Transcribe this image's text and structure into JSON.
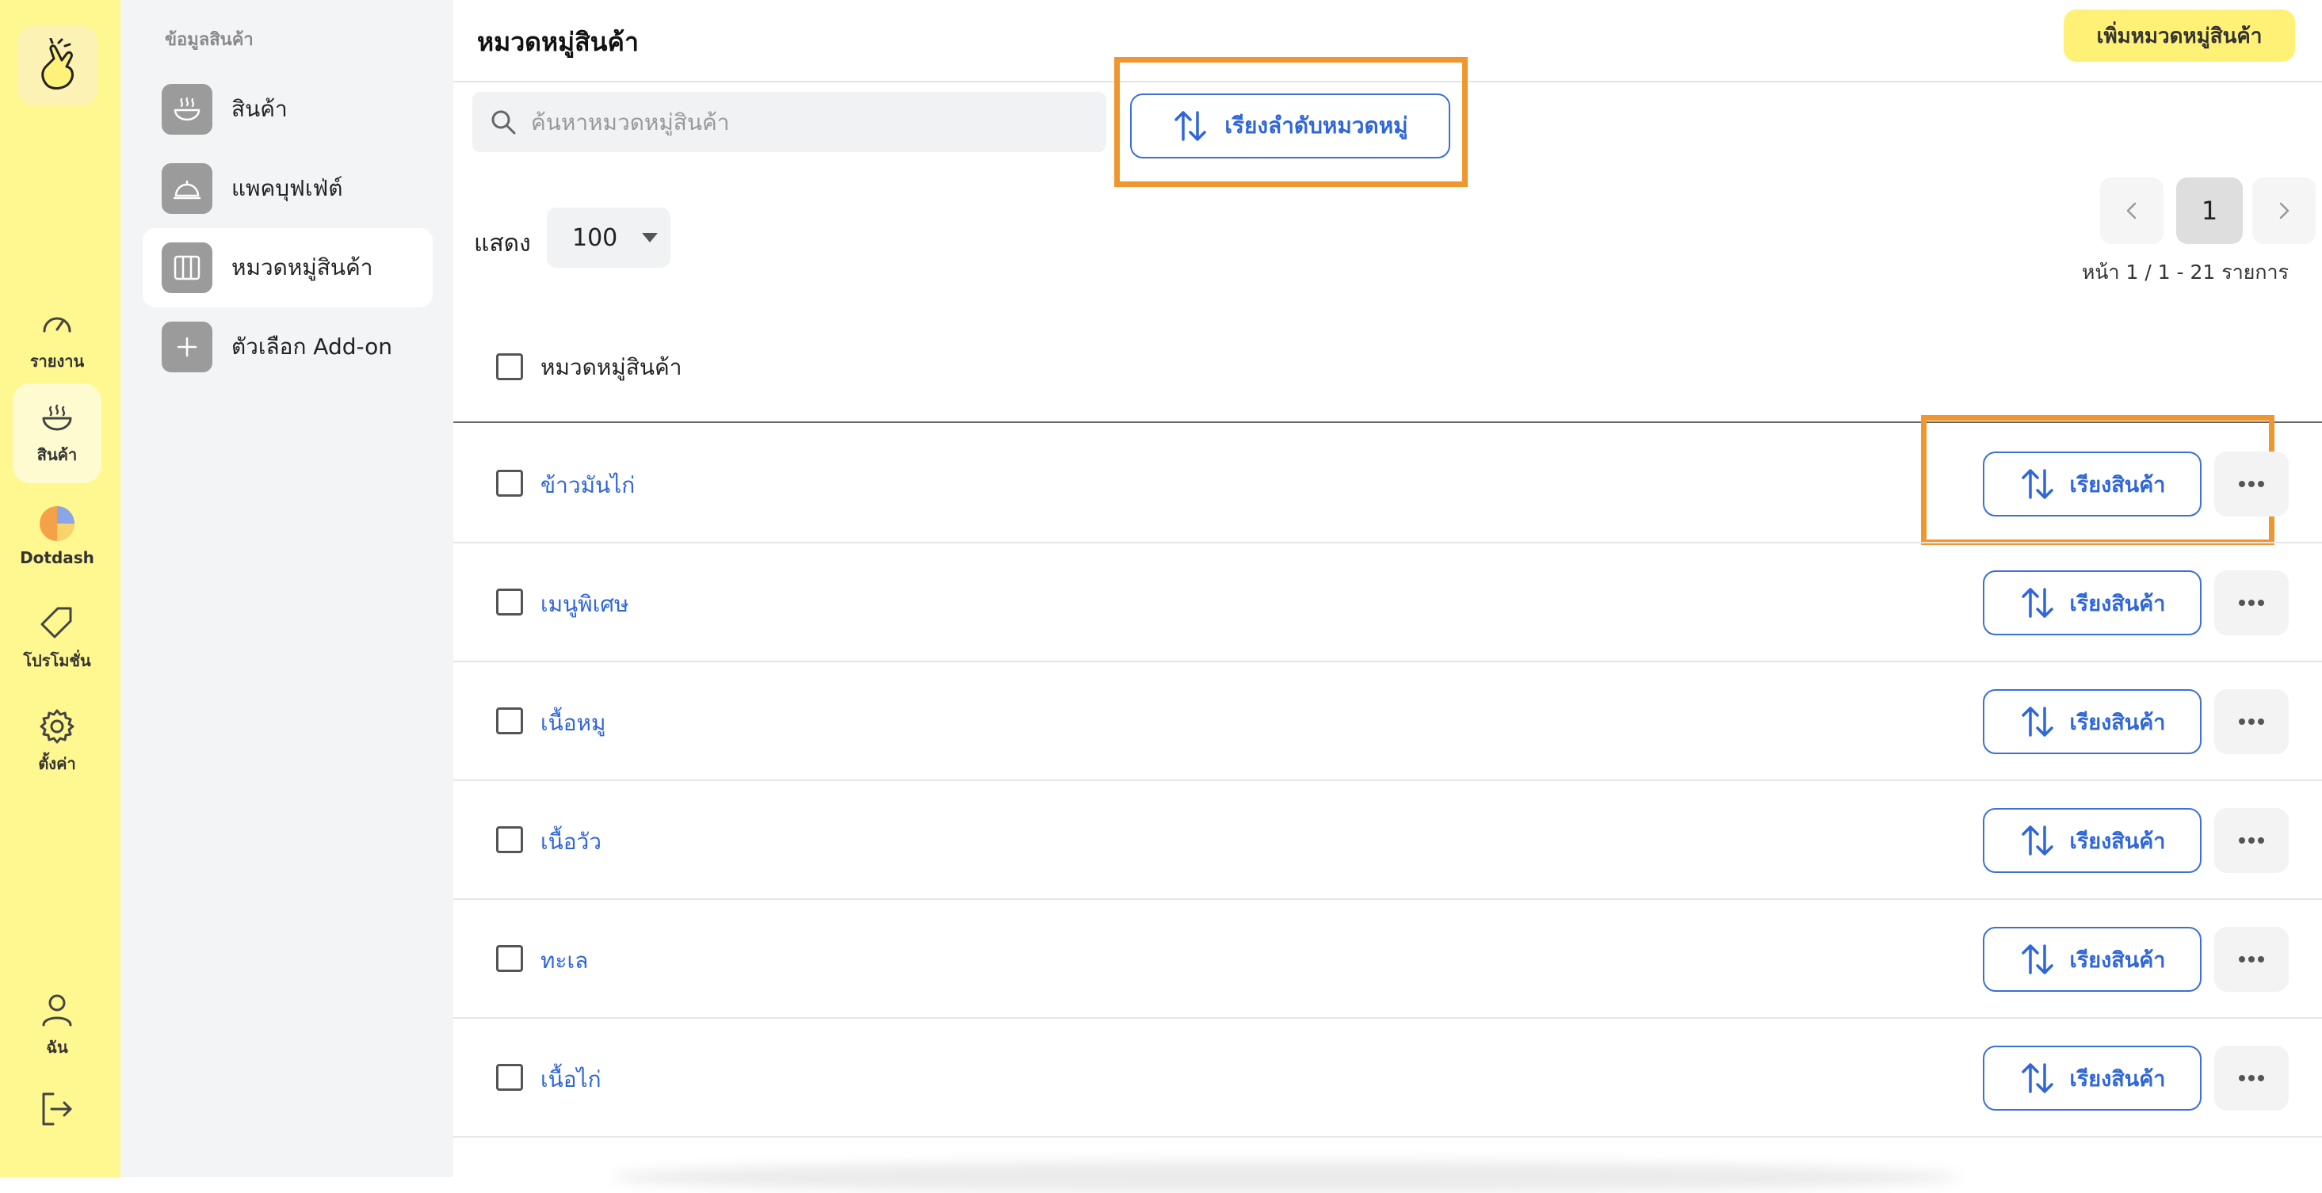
{
  "rail": {
    "items": [
      {
        "label": "รายงาน",
        "icon": "gauge-icon"
      },
      {
        "label": "สินค้า",
        "icon": "bowl-icon",
        "active": true
      },
      {
        "label": "Dotdash",
        "icon": "dotdash-icon"
      },
      {
        "label": "โปรโมชั่น",
        "icon": "tag-icon"
      },
      {
        "label": "ตั้งค่า",
        "icon": "gear-icon"
      }
    ],
    "user_label": "ฉัน"
  },
  "subnav": {
    "title": "ข้อมูลสินค้า",
    "items": [
      {
        "label": "สินค้า",
        "icon": "bowl-icon"
      },
      {
        "label": "แพคบุฟเฟ่ต์",
        "icon": "cloche-icon"
      },
      {
        "label": "หมวดหมู่สินค้า",
        "icon": "columns-icon",
        "active": true
      },
      {
        "label": "ตัวเลือก Add-on",
        "icon": "plus-icon"
      }
    ]
  },
  "main": {
    "title": "หมวดหมู่สินค้า",
    "add_button": "เพิ่มหมวดหมู่สินค้า",
    "search_placeholder": "ค้นหาหมวดหมู่สินค้า",
    "sort_categories_button": "เรียงลำดับหมวดหมู่",
    "show_label": "แสดง",
    "page_size": "100",
    "pagination": {
      "current": "1",
      "info": "หน้า 1 / 1 - 21 รายการ"
    },
    "table": {
      "column": "หมวดหมู่สินค้า",
      "sort_items_label": "เรียงสินค้า",
      "rows": [
        "ข้าวมันไก่",
        "เมนูพิเศษ",
        "เนื้อหมู",
        "เนื้อวัว",
        "ทะเล",
        "เนื้อไก่"
      ]
    }
  },
  "colors": {
    "rail_bg": "#fff78f",
    "accent_blue": "#2f66d9",
    "highlight": "#f0962e",
    "add_button_bg": "#fff176"
  }
}
